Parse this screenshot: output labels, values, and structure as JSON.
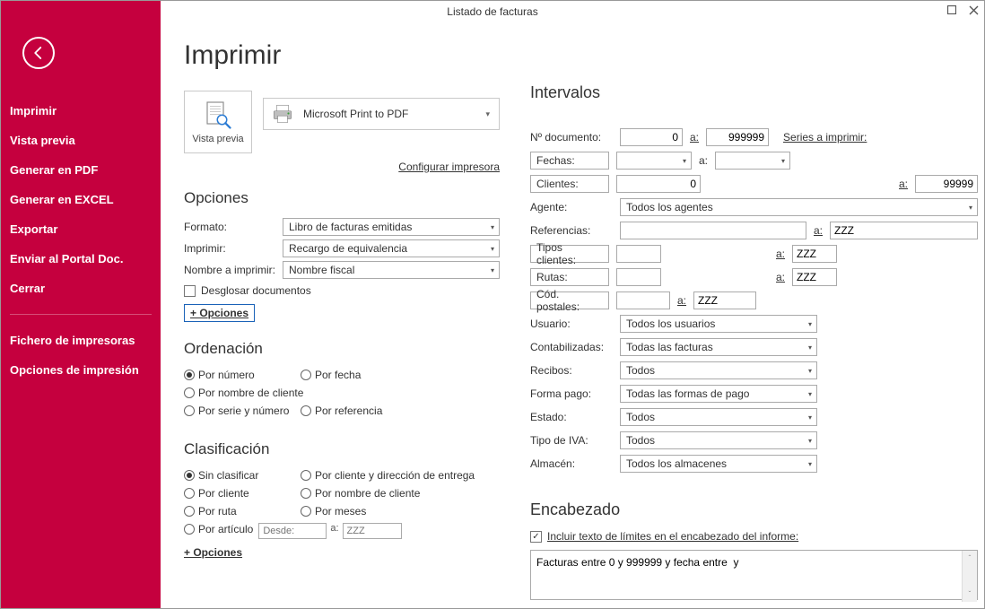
{
  "window": {
    "title": "Listado de facturas"
  },
  "sidebar": {
    "items": [
      "Imprimir",
      "Vista previa",
      "Generar en PDF",
      "Generar en EXCEL",
      "Exportar",
      "Enviar al Portal Doc.",
      "Cerrar"
    ],
    "items2": [
      "Fichero de impresoras",
      "Opciones de impresión"
    ]
  },
  "page": {
    "title": "Imprimir",
    "preview_label": "Vista previa",
    "printer": "Microsoft Print to PDF",
    "config_link": "Configurar impresora"
  },
  "opciones": {
    "title": "Opciones",
    "formato_label": "Formato:",
    "formato_value": "Libro de facturas emitidas",
    "imprimir_label": "Imprimir:",
    "imprimir_value": "Recargo de equivalencia",
    "nombre_label": "Nombre a imprimir:",
    "nombre_value": "Nombre fiscal",
    "desglosar": "Desglosar documentos",
    "mas": "+ Opciones"
  },
  "orden": {
    "title": "Ordenación",
    "por_numero": "Por número",
    "por_fecha": "Por fecha",
    "por_nombre": "Por nombre de cliente",
    "por_serie": "Por serie y número",
    "por_ref": "Por referencia"
  },
  "clasif": {
    "title": "Clasificación",
    "sin": "Sin clasificar",
    "cli_dir": "Por cliente y dirección de entrega",
    "cli": "Por cliente",
    "nombre": "Por nombre de cliente",
    "ruta": "Por ruta",
    "meses": "Por meses",
    "articulo": "Por artículo",
    "desde_ph": "Desde:",
    "a_label": "a:",
    "hasta_ph": "ZZZ",
    "mas": "+ Opciones"
  },
  "intervalos": {
    "title": "Intervalos",
    "ndoc_label": "Nº documento:",
    "ndoc_from": "0",
    "ndoc_to": "999999",
    "series": "Series a imprimir:",
    "fechas_label": "Fechas:",
    "clientes_label": "Clientes:",
    "clientes_from": "0",
    "clientes_to": "99999",
    "agente_label": "Agente:",
    "agente_value": "Todos los agentes",
    "ref_label": "Referencias:",
    "ref_to": "ZZZ",
    "tipos_label": "Tipos clientes:",
    "tipos_to": "ZZZ",
    "rutas_label": "Rutas:",
    "rutas_to": "ZZZ",
    "cp_label": "Cód. postales:",
    "cp_to": "ZZZ",
    "usuario_label": "Usuario:",
    "usuario_value": "Todos los usuarios",
    "contab_label": "Contabilizadas:",
    "contab_value": "Todas las facturas",
    "recibos_label": "Recibos:",
    "recibos_value": "Todos",
    "forma_label": "Forma pago:",
    "forma_value": "Todas las formas de pago",
    "estado_label": "Estado:",
    "estado_value": "Todos",
    "iva_label": "Tipo de IVA:",
    "iva_value": "Todos",
    "alm_label": "Almacén:",
    "alm_value": "Todos los almacenes",
    "a": "a:"
  },
  "encabezado": {
    "title": "Encabezado",
    "chk": "Incluir texto de límites en el encabezado del informe:",
    "text": "Facturas entre 0 y 999999 y fecha entre  y"
  }
}
